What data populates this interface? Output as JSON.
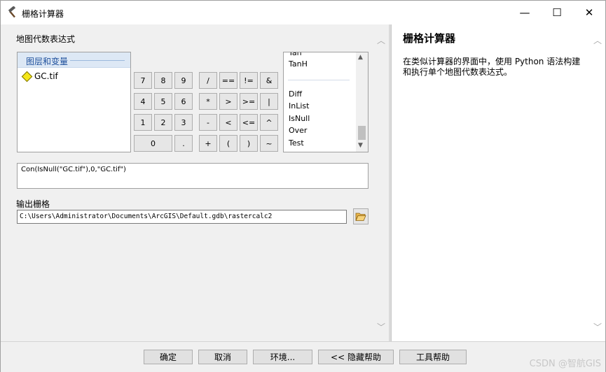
{
  "window": {
    "title": "栅格计算器",
    "minimize": "—",
    "maximize": "☐",
    "close": "✕"
  },
  "left": {
    "expr_label": "地图代数表达式",
    "layers_header": "图层和变量",
    "layers": [
      "GC.tif"
    ],
    "calc_buttons": {
      "b7": "7",
      "b8": "8",
      "b9": "9",
      "div": "/",
      "eq": "==",
      "neq": "!=",
      "and": "&",
      "b4": "4",
      "b5": "5",
      "b6": "6",
      "mul": "*",
      "gt": ">",
      "ge": ">=",
      "or": "|",
      "b1": "1",
      "b2": "2",
      "b3": "3",
      "sub": "-",
      "lt": "<",
      "le": "<=",
      "xor": "^",
      "b0": "0",
      "dot": ".",
      "add": "+",
      "lpar": "(",
      "rpar": ")",
      "not": "~"
    },
    "functions_top": [
      "Tan",
      "TanH"
    ],
    "functions": [
      "Diff",
      "InList",
      "IsNull",
      "Over",
      "Test"
    ],
    "expression": "Con(IsNull(\"GC.tif\"),0,\"GC.tif\")",
    "output_label": "输出栅格",
    "output_value": "C:\\Users\\Administrator\\Documents\\ArcGIS\\Default.gdb\\rastercalc2"
  },
  "help": {
    "title": "栅格计算器",
    "text": "在类似计算器的界面中，使用 Python 语法构建和执行单个地图代数表达式。"
  },
  "buttons": {
    "ok": "确定",
    "cancel": "取消",
    "env": "环境...",
    "hide_help": "<< 隐藏帮助",
    "tool_help": "工具帮助"
  },
  "watermark": "CSDN @智航GIS"
}
